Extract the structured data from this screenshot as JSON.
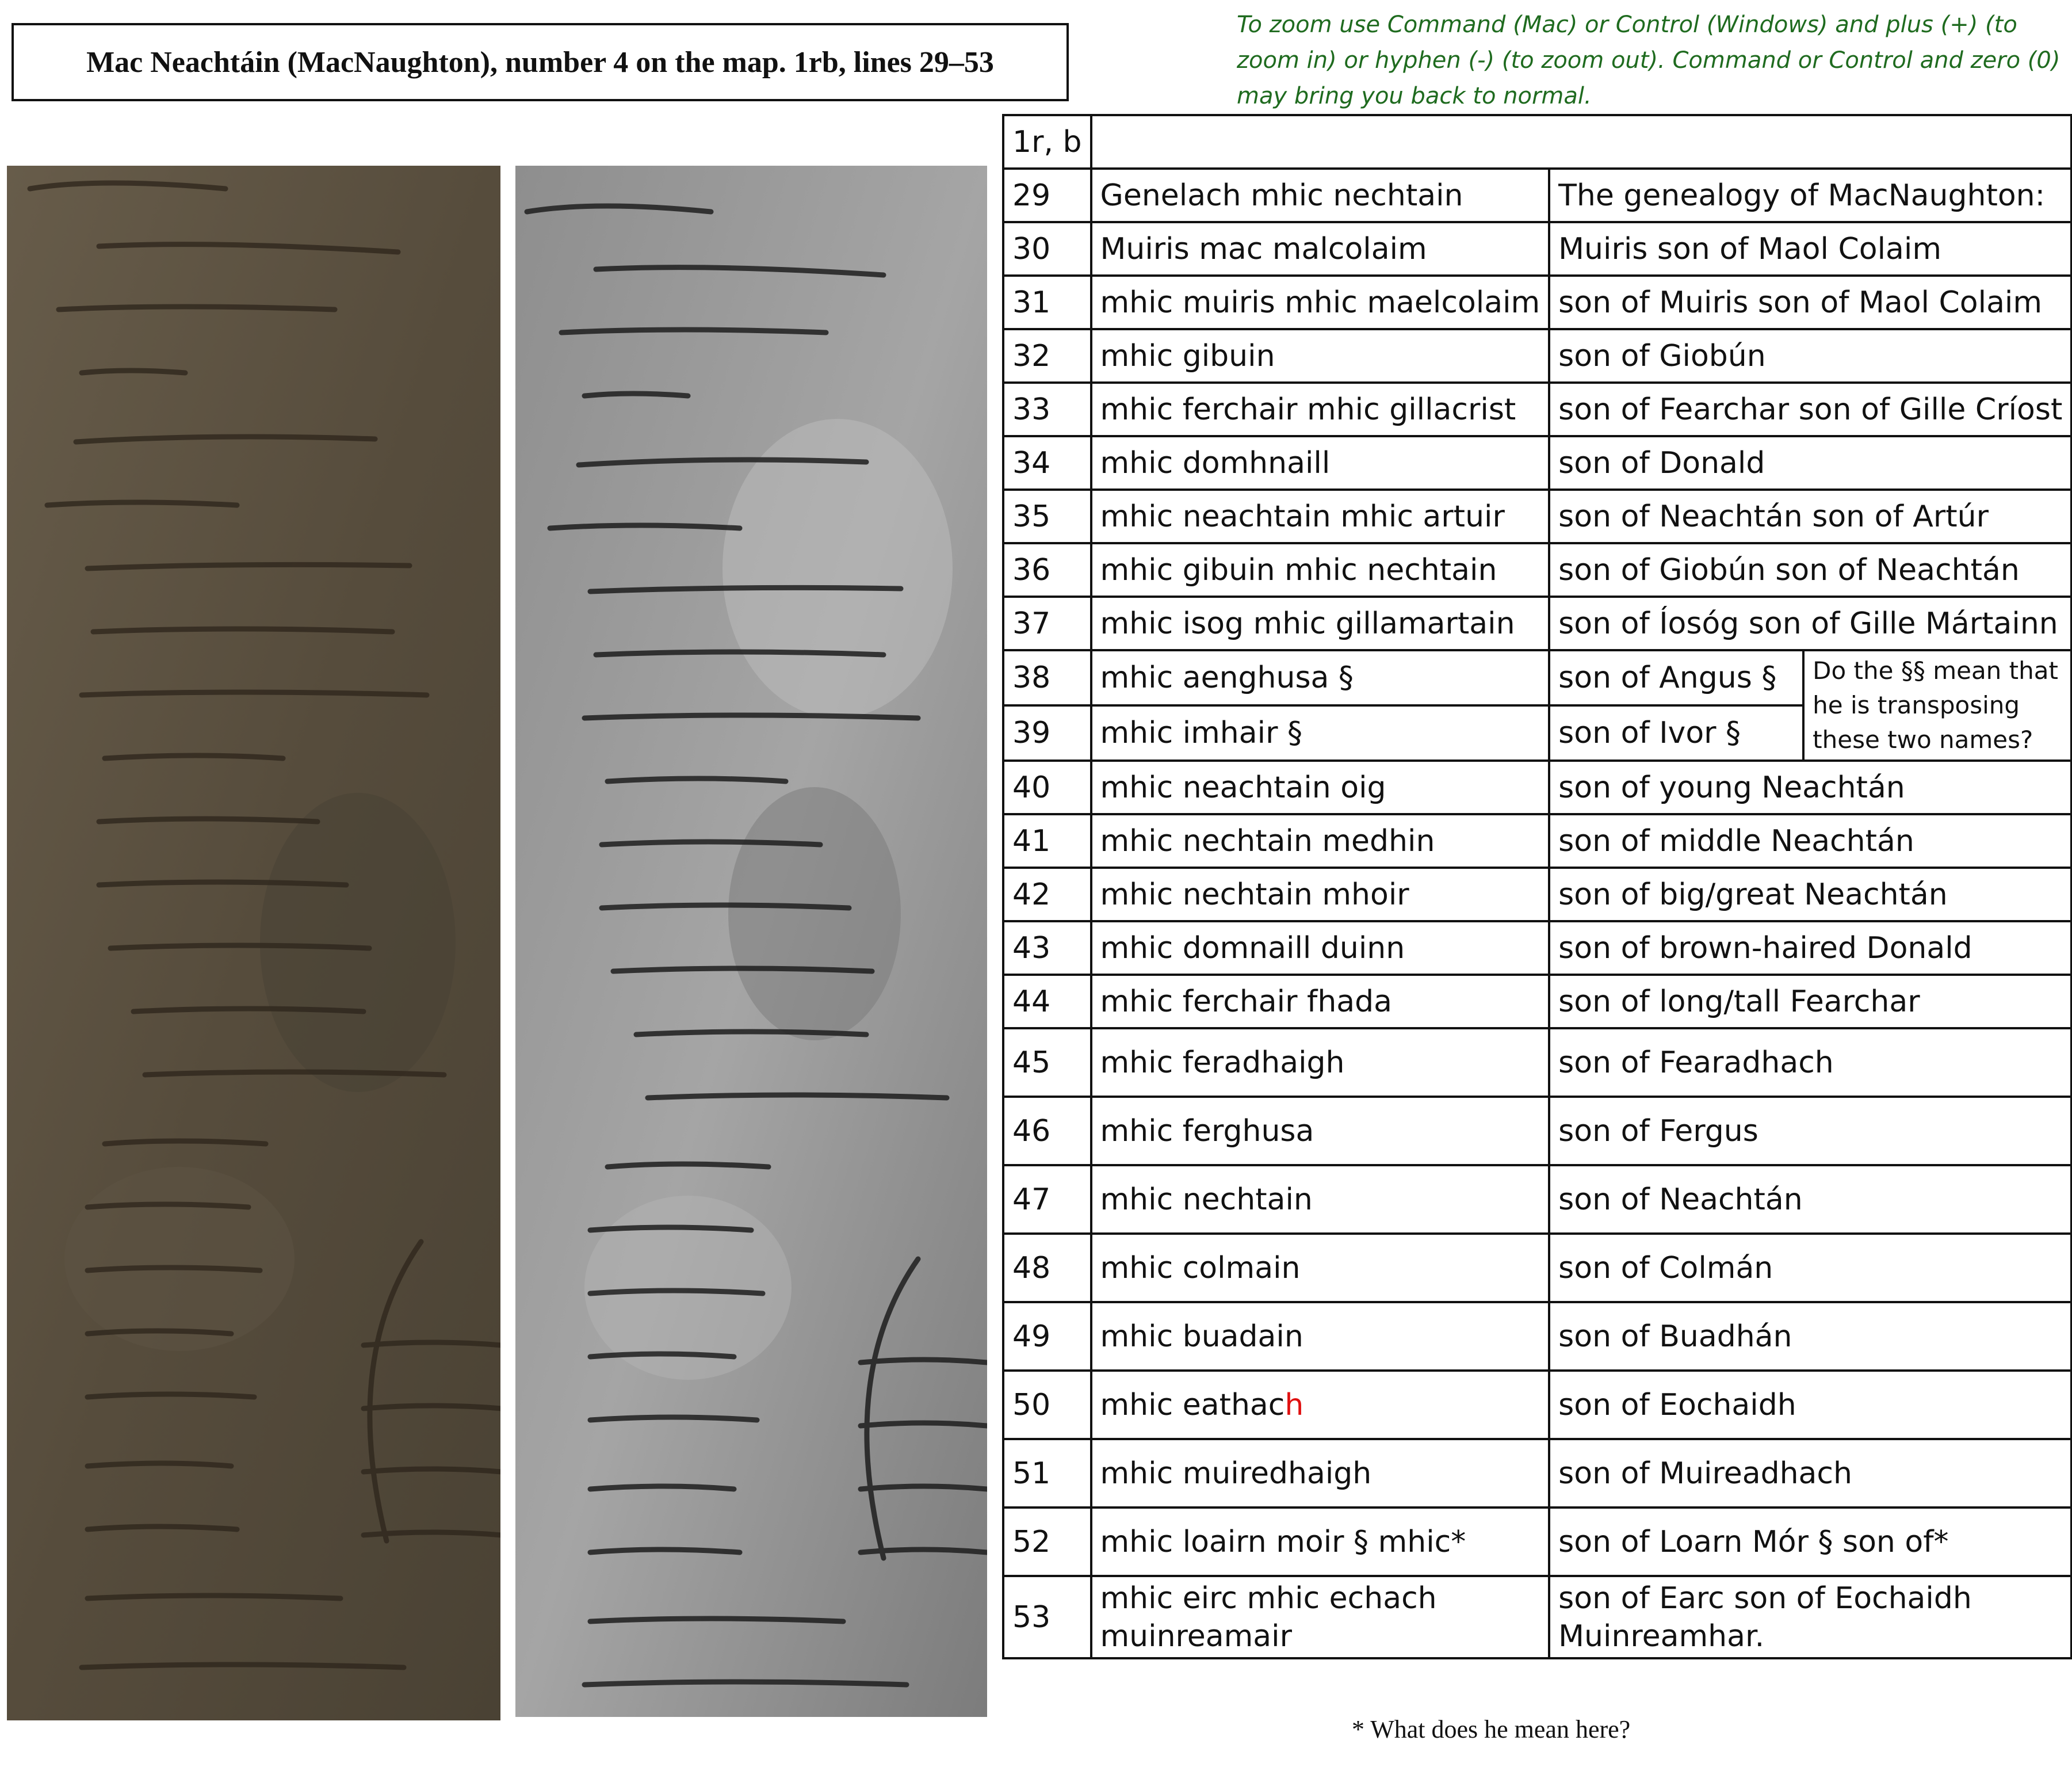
{
  "header": {
    "title": "Mac Neachtáin (MacNaughton), number 4 on the map. 1rb, lines 29–53",
    "zoom_instructions": "To zoom use Command (Mac) or Control (Windows) and plus (+) (to zoom in) or hyphen (-) (to zoom out).  Command or Control and zero (0) may bring you back to normal."
  },
  "images": {
    "colour": "manuscript-photo-colour",
    "greyscale": "manuscript-photo-greyscale"
  },
  "table": {
    "header_label": "1r, b",
    "rows": [
      {
        "n": "29",
        "irish": "Genelach mhic nechtain",
        "english": "The genealogy of MacNaughton:"
      },
      {
        "n": "30",
        "irish": "Muiris mac malcolaim",
        "english": "Muiris son of Maol Colaim"
      },
      {
        "n": "31",
        "irish": "mhic muiris mhic maelcolaim",
        "english": "son of Muiris son of Maol Colaim"
      },
      {
        "n": "32",
        "irish": "mhic gibuin",
        "english": "son of Giobún"
      },
      {
        "n": "33",
        "irish": "mhic ferchair mhic gillacrist",
        "english": "son of Fearchar son of Gille Críost"
      },
      {
        "n": "34",
        "irish": "mhic domhnaill",
        "english": "son of Donald"
      },
      {
        "n": "35",
        "irish": "mhic neachtain mhic artuir",
        "english": "son of Neachtán son of Artúr"
      },
      {
        "n": "36",
        "irish": "mhic gibuin mhic nechtain",
        "english": "son of Giobún son of Neachtán"
      },
      {
        "n": "37",
        "irish": "mhic isog mhic gillamartain",
        "english": "son of Íosóg son of Gille Mártainn"
      },
      {
        "n": "38",
        "irish": "mhic aenghusa §",
        "english": "son of Angus §"
      },
      {
        "n": "39",
        "irish": "mhic imhair §",
        "english": "son of Ivor §"
      },
      {
        "n": "40",
        "irish": "mhic neachtain oig",
        "english": "son of young Neachtán"
      },
      {
        "n": "41",
        "irish": "mhic nechtain medhin",
        "english": "son of middle Neachtán"
      },
      {
        "n": "42",
        "irish": "mhic nechtain mhoir",
        "english": "son of big/great Neachtán"
      },
      {
        "n": "43",
        "irish": "mhic domnaill duinn",
        "english": "son of brown-haired Donald"
      },
      {
        "n": "44",
        "irish": "mhic ferchair fhada",
        "english": "son of long/tall Fearchar"
      },
      {
        "n": "45",
        "irish": "mhic feradhaigh",
        "english": "son of Fearadhach"
      },
      {
        "n": "46",
        "irish": "mhic ferghusa",
        "english": "son of Fergus"
      },
      {
        "n": "47",
        "irish": "mhic nechtain",
        "english": "son of Neachtán"
      },
      {
        "n": "48",
        "irish": "mhic colmain",
        "english": "son of Colmán"
      },
      {
        "n": "49",
        "irish": "mhic buadain",
        "english": "son of Buadhán"
      },
      {
        "n": "50",
        "irish": "mhic eathac",
        "irish_red": "h",
        "english": "son of Eochaidh"
      },
      {
        "n": "51",
        "irish": "mhic muiredhaigh",
        "english": "son of Muireadhach"
      },
      {
        "n": "52",
        "irish": "mhic loairn moir § mhic*",
        "english": "son of Loarn Mór § son of*"
      },
      {
        "n": "53",
        "irish": "mhic eirc mhic echach muinreamair",
        "english": "son of Earc son of Eochaidh Muinreamhar."
      }
    ],
    "note_38_39": "Do the §§ mean that he is transposing these two names?"
  },
  "footnote": "* What does he mean here?"
}
